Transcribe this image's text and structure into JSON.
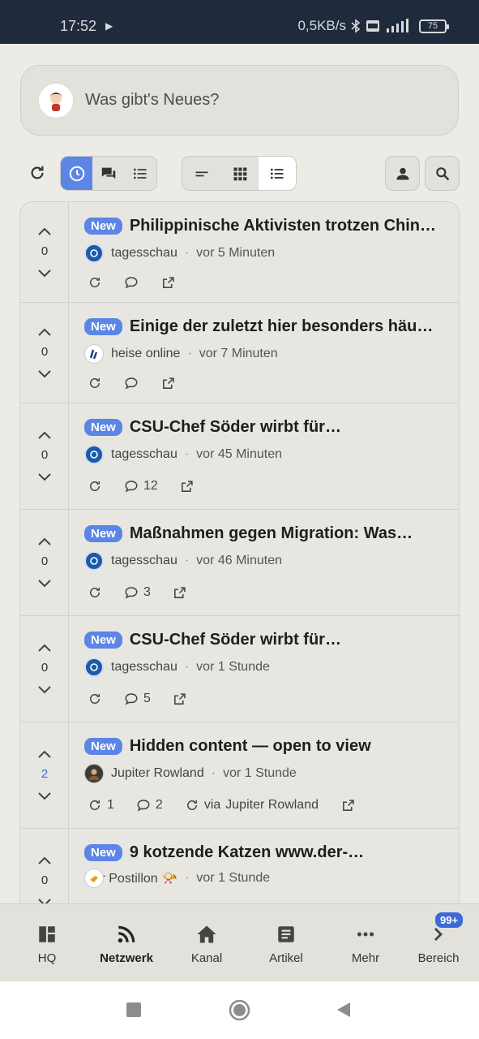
{
  "statusbar": {
    "time": "17:52",
    "network_speed": "0,5KB/s",
    "battery": "75"
  },
  "composer": {
    "placeholder": "Was gibt's Neues?"
  },
  "toolbar": {
    "icons": [
      "refresh-icon",
      "clock-icon",
      "chat-icon",
      "list-icon",
      "short-lines-icon",
      "grid-icon",
      "list-detail-icon",
      "person-icon",
      "search-icon"
    ]
  },
  "posts": [
    {
      "votes": "0",
      "badge": "New",
      "title": "Philippinische Aktivisten trotzen Chin…",
      "source": "tagesschau",
      "time": "vor 5 Minuten",
      "comments": ""
    },
    {
      "votes": "0",
      "badge": "New",
      "title": "Einige der zuletzt hier besonders häu…",
      "source": "heise online",
      "time": "vor 7 Minuten",
      "comments": ""
    },
    {
      "votes": "0",
      "badge": "New",
      "title": "CSU-Chef Söder wirbt für…",
      "source": "tagesschau",
      "time": "vor 45 Minuten",
      "comments": "12"
    },
    {
      "votes": "0",
      "badge": "New",
      "title": "Maßnahmen gegen Migration: Was…",
      "source": "tagesschau",
      "time": "vor 46 Minuten",
      "comments": "3"
    },
    {
      "votes": "0",
      "badge": "New",
      "title": "CSU-Chef Söder wirbt für…",
      "source": "tagesschau",
      "time": "vor 1 Stunde",
      "comments": "5"
    },
    {
      "votes": "2",
      "badge": "New",
      "title": "Hidden content — open to view",
      "source": "Jupiter Rowland",
      "time": "vor 1 Stunde",
      "reshares": "1",
      "comments": "2",
      "via_label": "via",
      "via_name": "Jupiter Rowland"
    },
    {
      "votes": "0",
      "badge": "New",
      "title": "9 kotzende Katzen www.der-…",
      "source": "Der Postillon 📯",
      "time": "vor 1 Stunde",
      "comments": ""
    }
  ],
  "bottomnav": {
    "items": [
      {
        "label": "HQ",
        "icon": "dashboard-icon"
      },
      {
        "label": "Netzwerk",
        "icon": "rss-icon"
      },
      {
        "label": "Kanal",
        "icon": "home-icon"
      },
      {
        "label": "Artikel",
        "icon": "article-icon"
      },
      {
        "label": "Mehr",
        "icon": "more-icon"
      },
      {
        "label": "Bereich",
        "icon": "chevron-right-icon"
      }
    ],
    "badge": "99+"
  },
  "colors": {
    "accent": "#5b86e5",
    "statusbar": "#1f2a3c",
    "background": "#ecebe6"
  }
}
